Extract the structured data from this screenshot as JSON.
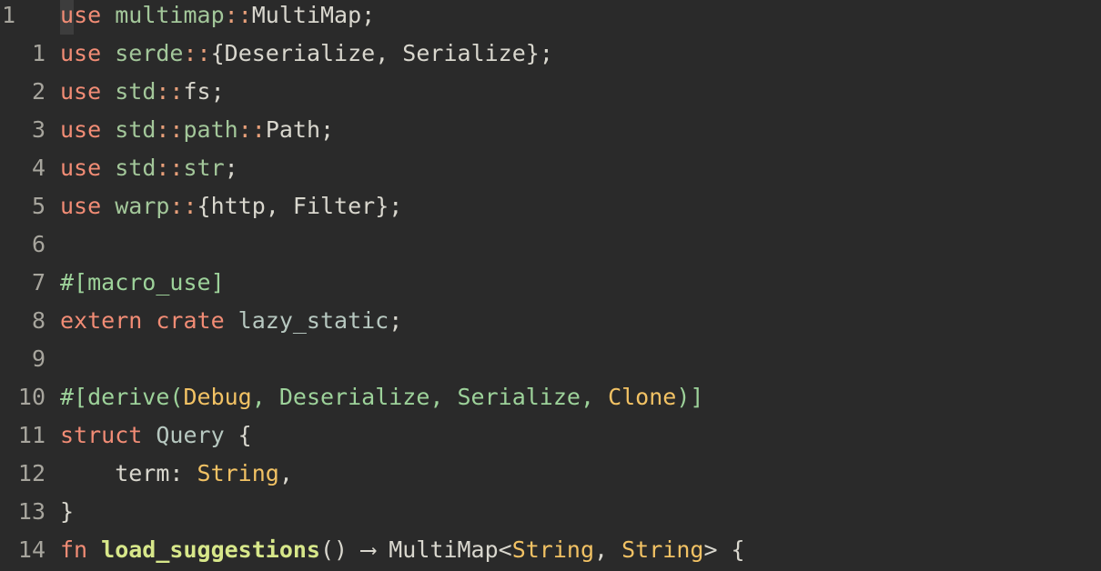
{
  "editor": {
    "lines": [
      {
        "num": "1",
        "tokens": [
          {
            "t": "u",
            "c": "kw cursor"
          },
          {
            "t": "se ",
            "c": "kw"
          },
          {
            "t": "multimap",
            "c": "mod"
          },
          {
            "t": "::",
            "c": "sep"
          },
          {
            "t": "MultiMap;",
            "c": "plain"
          }
        ]
      },
      {
        "num": "1",
        "tokens": [
          {
            "t": "use ",
            "c": "kw"
          },
          {
            "t": "serde",
            "c": "mod"
          },
          {
            "t": "::",
            "c": "sep"
          },
          {
            "t": "{Deserialize, Serialize};",
            "c": "plain"
          }
        ]
      },
      {
        "num": "2",
        "tokens": [
          {
            "t": "use ",
            "c": "kw"
          },
          {
            "t": "std",
            "c": "mod"
          },
          {
            "t": "::",
            "c": "sep"
          },
          {
            "t": "fs;",
            "c": "plain"
          }
        ]
      },
      {
        "num": "3",
        "tokens": [
          {
            "t": "use ",
            "c": "kw"
          },
          {
            "t": "std",
            "c": "mod"
          },
          {
            "t": "::",
            "c": "sep"
          },
          {
            "t": "path",
            "c": "mod"
          },
          {
            "t": "::",
            "c": "sep"
          },
          {
            "t": "Path;",
            "c": "plain"
          }
        ]
      },
      {
        "num": "4",
        "tokens": [
          {
            "t": "use ",
            "c": "kw"
          },
          {
            "t": "std",
            "c": "mod"
          },
          {
            "t": "::",
            "c": "sep"
          },
          {
            "t": "str",
            "c": "mod"
          },
          {
            "t": ";",
            "c": "plain"
          }
        ]
      },
      {
        "num": "5",
        "tokens": [
          {
            "t": "use ",
            "c": "kw"
          },
          {
            "t": "warp",
            "c": "mod"
          },
          {
            "t": "::",
            "c": "sep"
          },
          {
            "t": "{http, Filter};",
            "c": "plain"
          }
        ]
      },
      {
        "num": "6",
        "tokens": []
      },
      {
        "num": "7",
        "tokens": [
          {
            "t": "#[macro_use]",
            "c": "attr"
          }
        ]
      },
      {
        "num": "8",
        "tokens": [
          {
            "t": "extern crate ",
            "c": "kw"
          },
          {
            "t": "lazy_static",
            "c": "lazy"
          },
          {
            "t": ";",
            "c": "plain"
          }
        ]
      },
      {
        "num": "9",
        "tokens": []
      },
      {
        "num": "10",
        "tokens": [
          {
            "t": "#[derive(",
            "c": "attr"
          },
          {
            "t": "Debug",
            "c": "ty"
          },
          {
            "t": ", Deserialize, Serialize, ",
            "c": "attr"
          },
          {
            "t": "Clone",
            "c": "ty"
          },
          {
            "t": ")]",
            "c": "attr"
          }
        ]
      },
      {
        "num": "11",
        "tokens": [
          {
            "t": "struct ",
            "c": "kw"
          },
          {
            "t": "Query",
            "c": "lazy"
          },
          {
            "t": " {",
            "c": "plain"
          }
        ]
      },
      {
        "num": "12",
        "tokens": [
          {
            "t": "    term: ",
            "c": "plain"
          },
          {
            "t": "String",
            "c": "ty"
          },
          {
            "t": ",",
            "c": "plain"
          }
        ]
      },
      {
        "num": "13",
        "tokens": [
          {
            "t": "}",
            "c": "plain"
          }
        ]
      },
      {
        "num": "14",
        "tokens": [
          {
            "t": "fn ",
            "c": "kw"
          },
          {
            "t": "load_suggestions",
            "c": "fnname"
          },
          {
            "t": "() ⟶ MultiMap<",
            "c": "plain"
          },
          {
            "t": "String",
            "c": "ty"
          },
          {
            "t": ", ",
            "c": "plain"
          },
          {
            "t": "String",
            "c": "ty"
          },
          {
            "t": "> {",
            "c": "plain"
          }
        ]
      }
    ]
  }
}
